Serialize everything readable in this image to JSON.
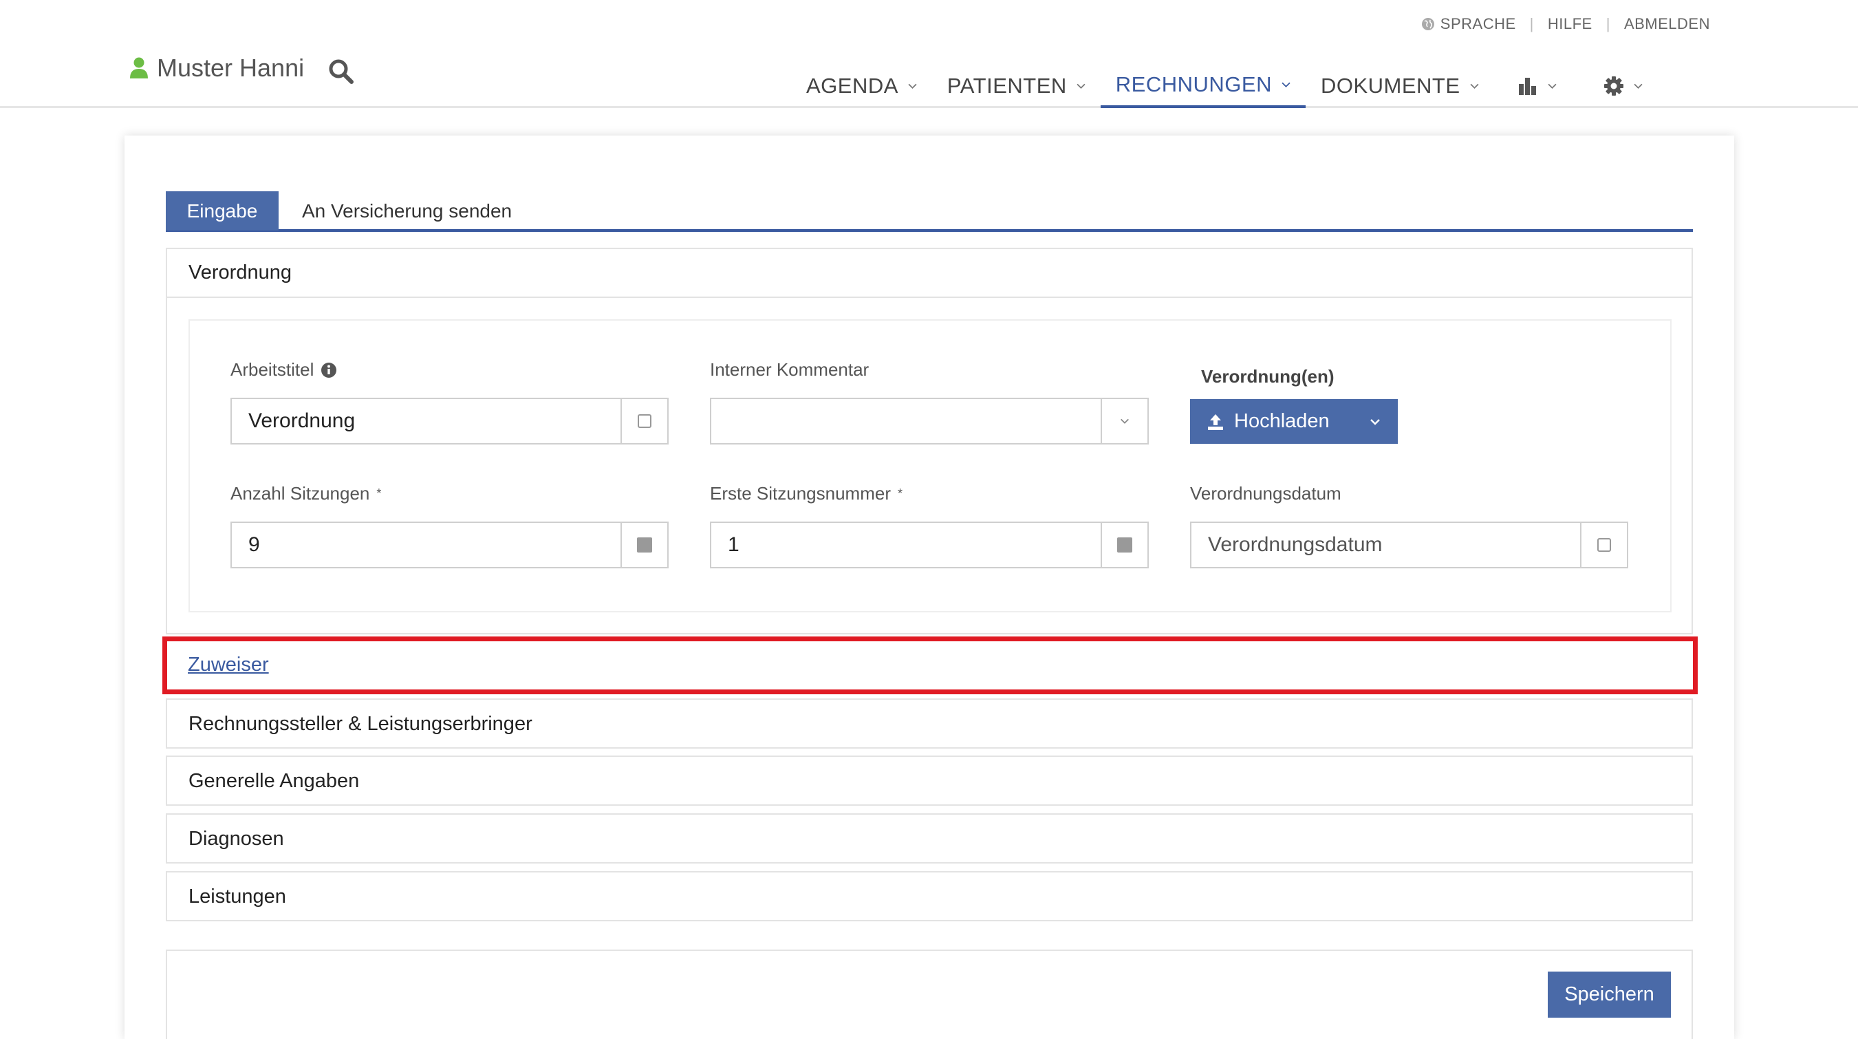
{
  "top_links": {
    "language": "SPRACHE",
    "help": "HILFE",
    "logout": "ABMELDEN"
  },
  "user": {
    "name": "Muster Hanni"
  },
  "nav": {
    "agenda": "AGENDA",
    "patients": "PATIENTEN",
    "invoices": "RECHNUNGEN",
    "documents": "DOKUMENTE"
  },
  "tabs": {
    "input": "Eingabe",
    "send": "An Versicherung senden"
  },
  "verordnung": {
    "title": "Verordnung",
    "arbeitstitel": {
      "label": "Arbeitstitel",
      "value": "Verordnung"
    },
    "kommentar": {
      "label": "Interner Kommentar",
      "value": ""
    },
    "verordnungen": {
      "label": "Verordnung(en)",
      "upload_label": "Hochladen"
    },
    "anzahl": {
      "label": "Anzahl Sitzungen",
      "required_mark": "*",
      "value": "9"
    },
    "erste": {
      "label": "Erste Sitzungsnummer",
      "required_mark": "*",
      "value": "1"
    },
    "datum": {
      "label": "Verordnungsdatum",
      "placeholder": "Verordnungsdatum"
    }
  },
  "sections": {
    "zuweiser": "Zuweiser",
    "rechnungssteller": "Rechnungssteller & Leistungserbringer",
    "generelle": "Generelle Angaben",
    "diagnosen": "Diagnosen",
    "leistungen": "Leistungen"
  },
  "actions": {
    "save": "Speichern"
  },
  "colors": {
    "primary": "#4a6aa8",
    "active_nav": "#3a5aa0",
    "user_icon": "#6cbd45",
    "highlight": "#e01b24"
  }
}
